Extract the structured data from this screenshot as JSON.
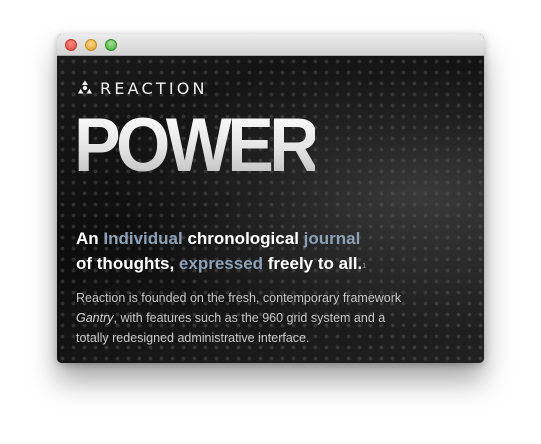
{
  "window": {
    "controls": [
      "close",
      "minimize",
      "maximize"
    ]
  },
  "brand": {
    "name": "REACTION",
    "logo_icon": "reaction-logo-icon"
  },
  "hero": {
    "title": "POWER"
  },
  "tagline": {
    "parts": [
      {
        "text": "An ",
        "highlight": false
      },
      {
        "text": "Individual",
        "highlight": true
      },
      {
        "text": " chronological ",
        "highlight": false
      },
      {
        "text": "journal",
        "highlight": true
      },
      {
        "text": "of thoughts, ",
        "highlight": false
      },
      {
        "text": "expressed",
        "highlight": true
      },
      {
        "text": " freely to all.",
        "highlight": false
      }
    ],
    "footnote": "1"
  },
  "description": {
    "before": "Reaction is founded on the fresh, contemporary framework ",
    "emphasis": "Gantry",
    "after": ", with features such as the 960 grid system and a totally redesigned administrative interface."
  },
  "colors": {
    "highlight": "#8da2b6",
    "background": "#111111",
    "text": "#ffffff"
  }
}
